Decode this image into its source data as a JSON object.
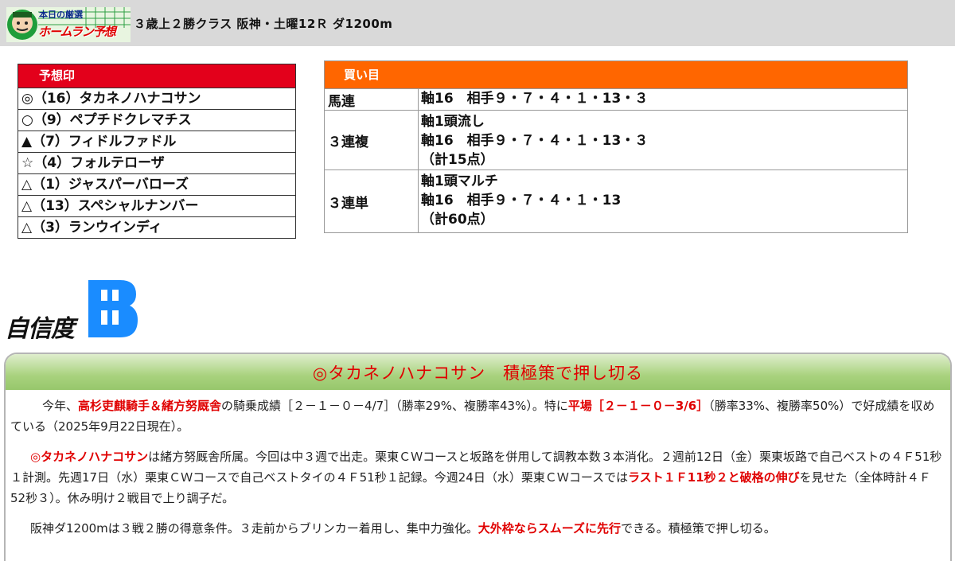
{
  "header": {
    "logo_text_top": "本日の厳選",
    "logo_text_main": "ホームラン予想",
    "race_title": "３歳上２勝クラス 阪神・土曜12Ｒ ダ1200m"
  },
  "marks": {
    "title": "予想印",
    "rows": [
      "◎（16）タカネノハナコサン",
      "○（9）ペプチドクレマチス",
      "▲（7）フィドルファドル",
      "☆（4）フォルテローザ",
      "△（1）ジャスパーバローズ",
      "△（13）スペシャルナンバー",
      "△（3）ランウインディ"
    ]
  },
  "buys": {
    "title": "買い目",
    "rows": [
      {
        "type": "馬連",
        "lines": [
          "軸16　相手９・７・４・１・13・３"
        ]
      },
      {
        "type": "３連複",
        "lines": [
          "軸1頭流し",
          "軸16　相手９・７・４・１・13・３",
          "（計15点）"
        ]
      },
      {
        "type": "３連単",
        "lines": [
          "軸1頭マルチ",
          "軸16　相手９・７・４・１・13",
          "（計60点）"
        ]
      }
    ]
  },
  "confidence": {
    "label": "自信度",
    "grade": "B"
  },
  "analysis": {
    "heading": "◎タカネノハナコサン　積極策で押し切る",
    "p1": [
      {
        "t": "今年、",
        "hl": false
      },
      {
        "t": "高杉吏麒騎手＆緒方努厩舎",
        "hl": true
      },
      {
        "t": "の騎乗成績［２－１－０－4/7］（勝率29%、複勝率43%）。特に",
        "hl": false
      },
      {
        "t": "平場［２－１－０－3/6］",
        "hl": true
      },
      {
        "t": "（勝率33%、複勝率50%）で好成績を収めている（2025年9月22日現在）。",
        "hl": false
      }
    ],
    "p2": [
      {
        "t": "◎タカネノハナコサン",
        "hl": true
      },
      {
        "t": "は緒方努厩舎所属。今回は中３週で出走。栗東ＣＷコースと坂路を併用して調教本数３本消化。２週前12日（金）栗東坂路で自己ベストの４Ｆ51秒１計測。先週17日（水）栗東ＣＷコースで自己ベストタイの４Ｆ51秒１記録。今週24日（水）栗東ＣＷコースでは",
        "hl": false
      },
      {
        "t": "ラスト１Ｆ11秒２と破格の伸び",
        "hl": true
      },
      {
        "t": "を見せた（全体時計４Ｆ52秒３）。休み明け２戦目で上り調子だ。",
        "hl": false
      }
    ],
    "p3": [
      {
        "t": "阪神ダ1200mは３戦２勝の得意条件。３走前からブリンカー着用し、集中力強化。",
        "hl": false
      },
      {
        "t": "大外枠ならスムーズに先行",
        "hl": true
      },
      {
        "t": "できる。積極策で押し切る。",
        "hl": false
      }
    ]
  }
}
